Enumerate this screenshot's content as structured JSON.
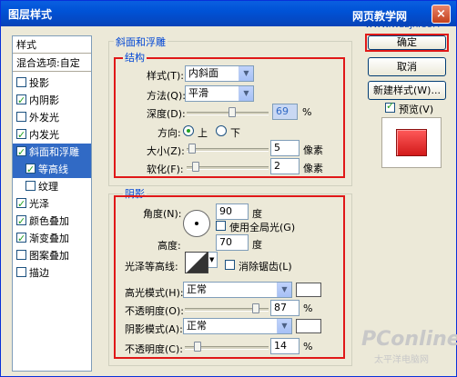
{
  "window": {
    "title": "图层样式",
    "close_label": "×",
    "watermark_top": "网页教学网",
    "watermark_top_url": "WWW.WEBJX.COM"
  },
  "sidebar": {
    "header": "样式",
    "blend": "混合选项:自定",
    "items": [
      {
        "label": "投影",
        "checked": false
      },
      {
        "label": "内阴影",
        "checked": true
      },
      {
        "label": "外发光",
        "checked": false
      },
      {
        "label": "内发光",
        "checked": true
      },
      {
        "label": "斜面和浮雕",
        "checked": true,
        "selected": true
      },
      {
        "label": "等高线",
        "checked": true,
        "sub": true
      },
      {
        "label": "纹理",
        "checked": false,
        "sub": true
      },
      {
        "label": "光泽",
        "checked": true
      },
      {
        "label": "颜色叠加",
        "checked": true
      },
      {
        "label": "渐变叠加",
        "checked": true
      },
      {
        "label": "图案叠加",
        "checked": false
      },
      {
        "label": "描边",
        "checked": false
      }
    ]
  },
  "bevel": {
    "group_title": "斜面和浮雕",
    "structure_title": "结构",
    "style_label": "样式(T):",
    "style_value": "内斜面",
    "method_label": "方法(Q):",
    "method_value": "平滑",
    "depth_label": "深度(D):",
    "depth_value": "69",
    "depth_unit": "%",
    "direction_label": "方向:",
    "dir_up": "上",
    "dir_down": "下",
    "size_label": "大小(Z):",
    "size_value": "5",
    "size_unit": "像素",
    "soften_label": "软化(F):",
    "soften_value": "2",
    "soften_unit": "像素"
  },
  "shading": {
    "title": "阴影",
    "angle_label": "角度(N):",
    "angle_value": "90",
    "angle_unit": "度",
    "global_light": "使用全局光(G)",
    "altitude_label": "高度:",
    "altitude_value": "70",
    "altitude_unit": "度",
    "gloss_label": "光泽等高线:",
    "antialias": "消除锯齿(L)",
    "highlight_mode_label": "高光模式(H):",
    "highlight_mode": "正常",
    "highlight_opacity_label": "不透明度(O):",
    "highlight_opacity": "87",
    "shadow_mode_label": "阴影模式(A):",
    "shadow_mode": "正常",
    "shadow_opacity_label": "不透明度(C):",
    "shadow_opacity": "14",
    "pct": "%"
  },
  "buttons": {
    "ok": "确定",
    "cancel": "取消",
    "new_style": "新建样式(W)...",
    "preview": "预览(V)"
  },
  "watermark": {
    "brand": "PConline",
    "sub": "太平洋电脑网"
  },
  "colors": {
    "accent_red": "#e01818",
    "selection": "#316ac5",
    "preview_red": "#d21a1a"
  }
}
